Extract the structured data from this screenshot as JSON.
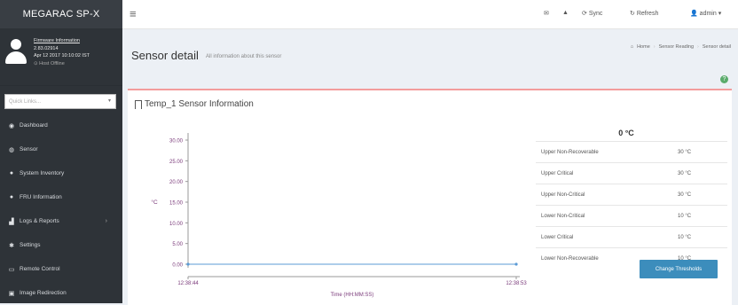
{
  "brand": "MEGARAC SP-X",
  "user_panel": {
    "firmware_link": "Firmware Information",
    "version": "2.83.02914",
    "date": "Apr 12 2017 10:10:02 IST",
    "host_status": "Host Offline"
  },
  "quick_links": {
    "placeholder": "Quick Links..."
  },
  "nav": [
    {
      "label": "Dashboard",
      "icon": "dashboard-icon"
    },
    {
      "label": "Sensor",
      "icon": "sensor-icon"
    },
    {
      "label": "System Inventory",
      "icon": "info-icon"
    },
    {
      "label": "FRU Information",
      "icon": "info-icon"
    },
    {
      "label": "Logs & Reports",
      "icon": "chart-icon"
    },
    {
      "label": "Settings",
      "icon": "gear-icon"
    },
    {
      "label": "Remote Control",
      "icon": "monitor-icon"
    },
    {
      "label": "Image Redirection",
      "icon": "disc-icon"
    }
  ],
  "topbar": {
    "sync": "Sync",
    "refresh": "Refresh",
    "user": "admin"
  },
  "page": {
    "title": "Sensor detail",
    "subtitle": "All information about this sensor",
    "breadcrumbs": [
      "Home",
      "Sensor Reading",
      "Sensor detail"
    ]
  },
  "box": {
    "title": "Temp_1 Sensor Information"
  },
  "current_reading": "0 °C",
  "thresholds": [
    {
      "label": "Upper Non-Recoverable",
      "value": "30 °C"
    },
    {
      "label": "Upper Critical",
      "value": "30 °C"
    },
    {
      "label": "Upper Non-Critical",
      "value": "30 °C"
    },
    {
      "label": "Lower Non-Critical",
      "value": "10 °C"
    },
    {
      "label": "Lower Critical",
      "value": "10 °C"
    },
    {
      "label": "Lower Non-Recoverable",
      "value": "10 °C"
    }
  ],
  "change_thresholds_label": "Change Thresholds",
  "chart_data": {
    "type": "line",
    "title": "",
    "xlabel": "Time (HH:MM:SS)",
    "ylabel": "°C",
    "y_ticks": [
      "30.00",
      "25.00",
      "20.00",
      "15.00",
      "10.00",
      "5.00",
      "0.00"
    ],
    "ylim": [
      0,
      30
    ],
    "x": [
      "12:38:44",
      "12:38:53"
    ],
    "series": [
      {
        "values": [
          0,
          0
        ]
      }
    ],
    "colors": {
      "line": "#5b9bd5",
      "axis_text": "#7a3a7a"
    }
  }
}
